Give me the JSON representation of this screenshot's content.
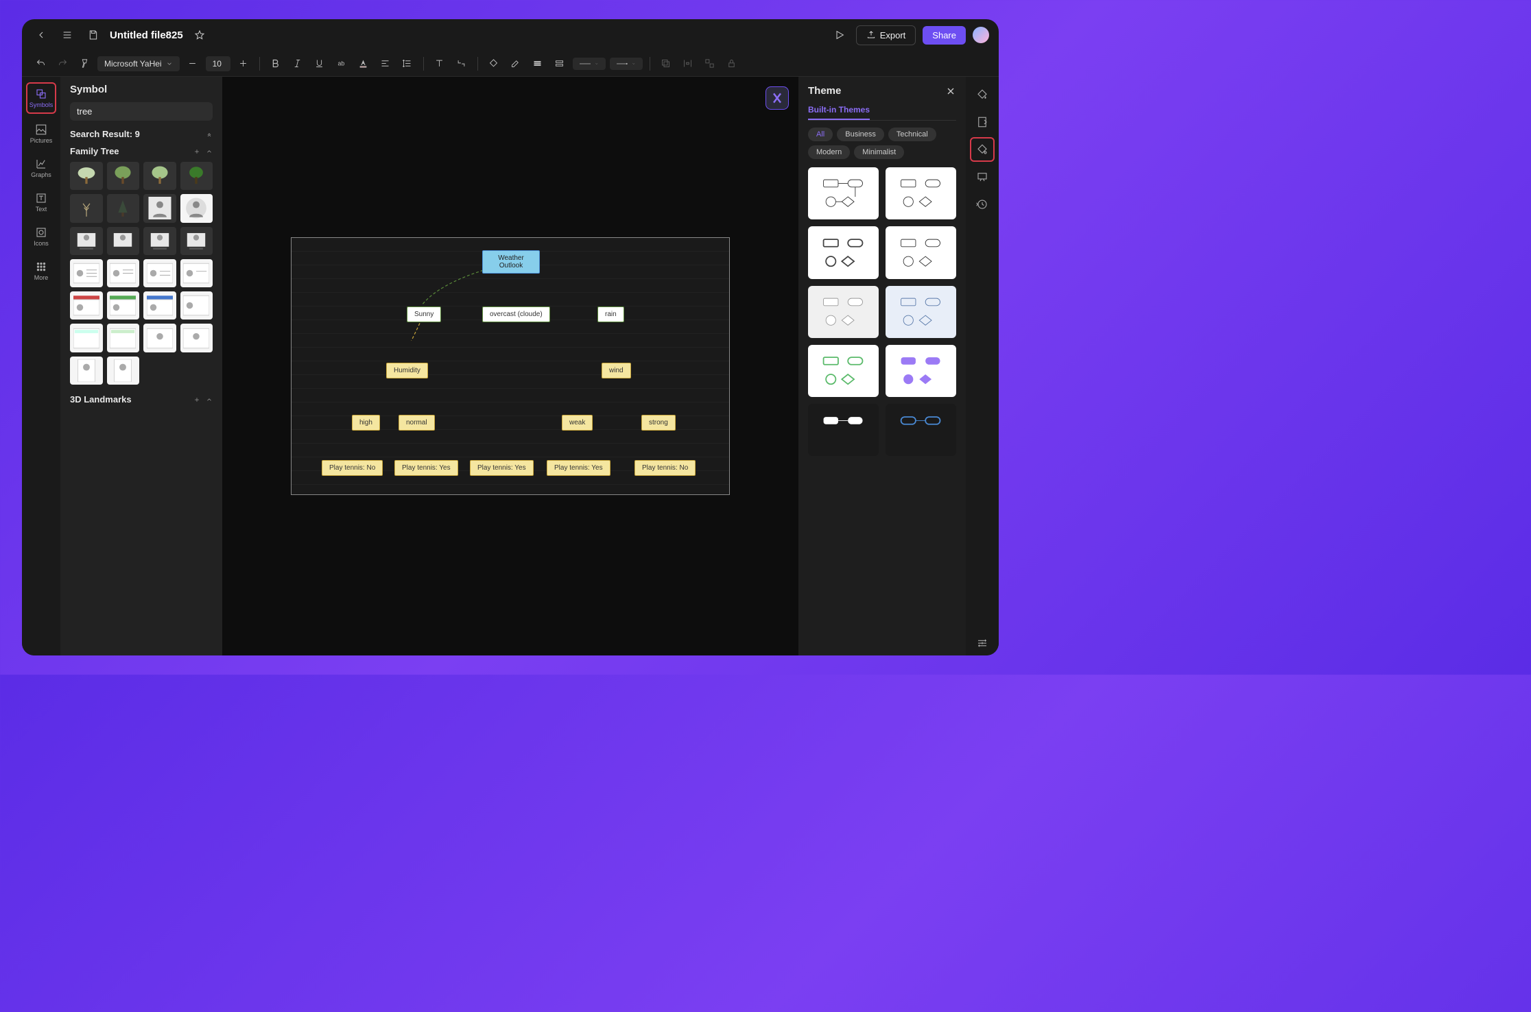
{
  "header": {
    "file_title": "Untitled file825",
    "export_label": "Export",
    "share_label": "Share"
  },
  "toolbar": {
    "font_family": "Microsoft YaHei",
    "font_size": "10"
  },
  "leftnav": {
    "items": [
      {
        "label": "Symbols"
      },
      {
        "label": "Pictures"
      },
      {
        "label": "Graphs"
      },
      {
        "label": "Text"
      },
      {
        "label": "Icons"
      },
      {
        "label": "More"
      }
    ]
  },
  "symbol_panel": {
    "title": "Symbol",
    "search_value": "tree",
    "result_label": "Search Result: 9",
    "section_family": "Family Tree",
    "section_landmarks": "3D Landmarks"
  },
  "canvas": {
    "nodes": {
      "root": "Weather Outlook",
      "sunny": "Sunny",
      "overcast": "overcast (cloude)",
      "rain": "rain",
      "humidity": "Humidity",
      "wind": "wind",
      "high": "high",
      "normal": "normal",
      "weak": "weak",
      "strong": "strong",
      "l1": "Play tennis: No",
      "l2": "Play tennis: Yes",
      "l3": "Play tennis: Yes",
      "l4": "Play tennis: Yes",
      "l5": "Play tennis: No"
    }
  },
  "theme_panel": {
    "title": "Theme",
    "tab_label": "Built-in Themes",
    "filters": [
      "All",
      "Business",
      "Technical",
      "Modern",
      "Minimalist"
    ]
  },
  "colors": {
    "accent": "#6d4ef2",
    "highlight_border": "#d73a4a"
  }
}
